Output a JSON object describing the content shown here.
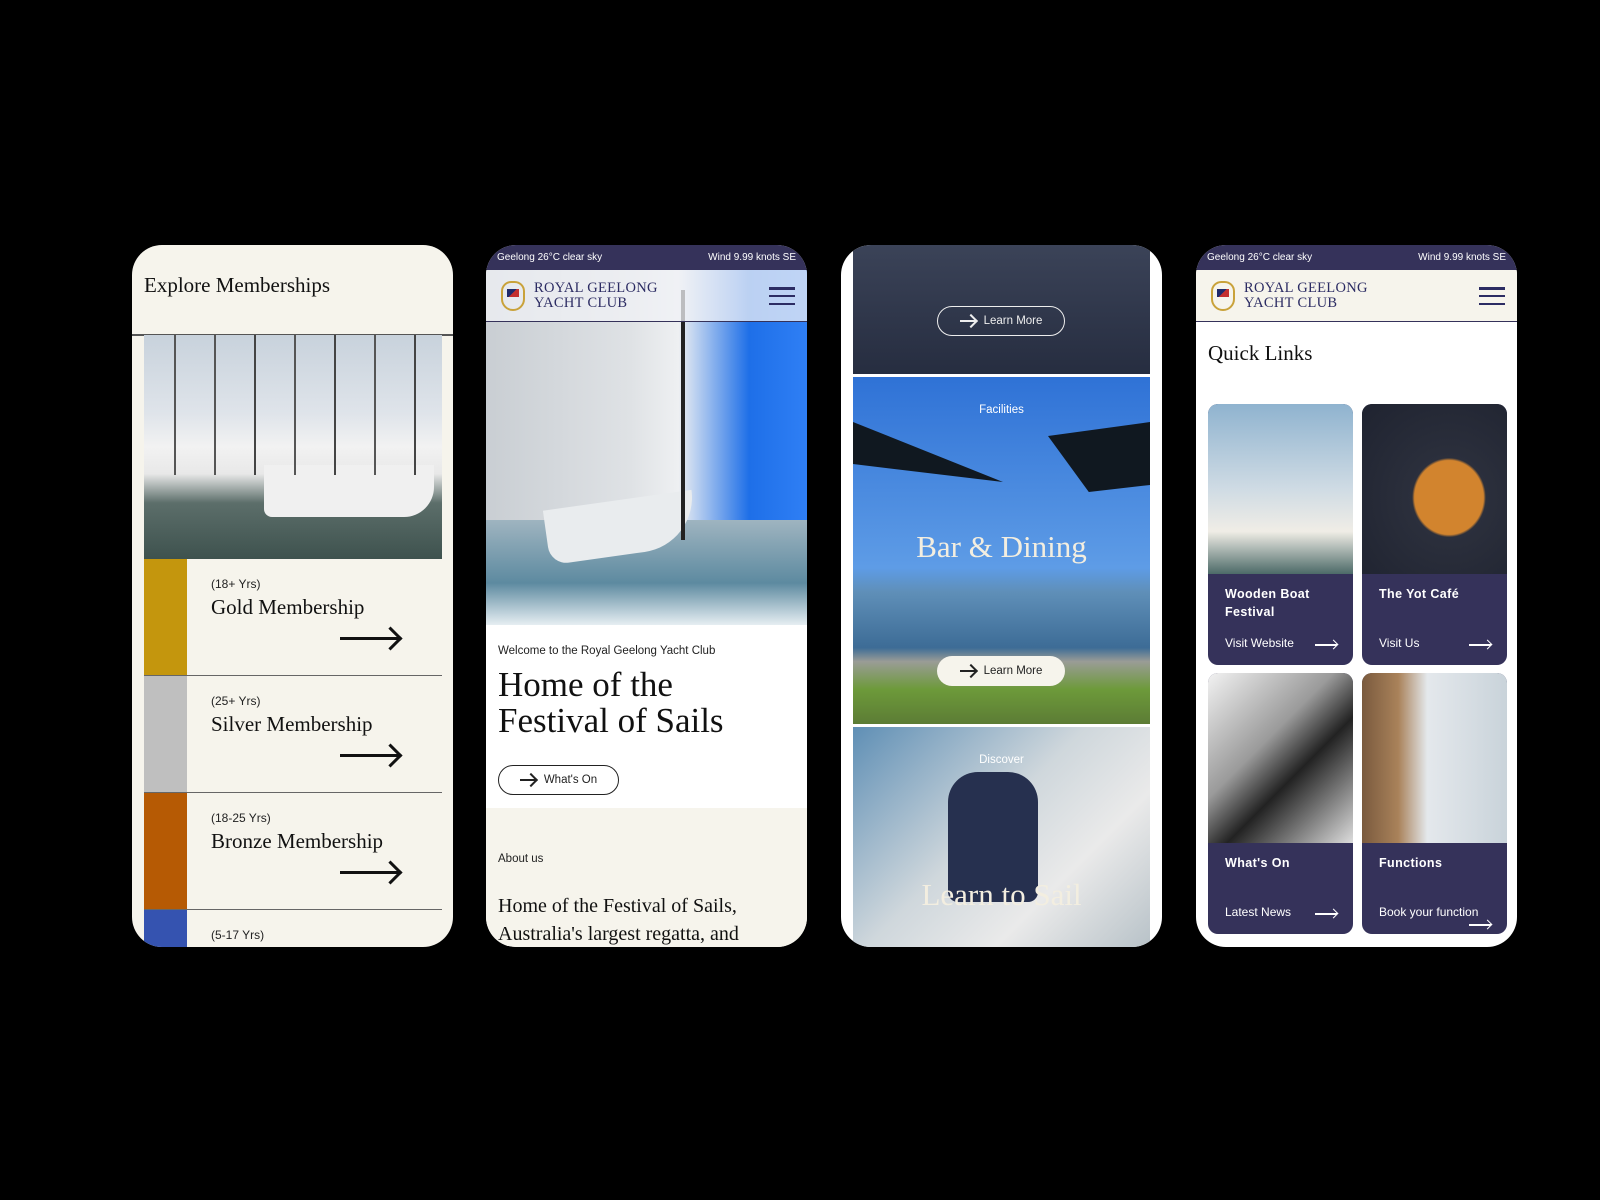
{
  "status_bar": {
    "weather": "Geelong 26°C clear sky",
    "wind": "Wind 9.99 knots SE"
  },
  "brand": {
    "line1": "ROYAL GEELONG",
    "line2": "YACHT CLUB"
  },
  "memberships": {
    "title": "Explore Memberships",
    "items": [
      {
        "age": "(18+ Yrs)",
        "name": "Gold Membership",
        "color": "#c4960d"
      },
      {
        "age": "(25+ Yrs)",
        "name": "Silver Membership",
        "color": "#bfbfbf"
      },
      {
        "age": "(18-25 Yrs)",
        "name": "Bronze Membership",
        "color": "#b65a04"
      },
      {
        "age": "(5-17 Yrs)",
        "name": "",
        "color": "#3553b0"
      }
    ]
  },
  "home": {
    "welcome": "Welcome to the Royal Geelong Yacht Club",
    "heading_line1": "Home of the",
    "heading_line2": "Festival of Sails",
    "whats_on_button": "What's On",
    "about_label": "About us",
    "about_line1": "Home of the Festival of Sails,",
    "about_line2": "Australia's largest regatta, and"
  },
  "features": {
    "learn_more": "Learn More",
    "bar_label": "Facilities",
    "bar_title": "Bar & Dining",
    "sail_label": "Discover",
    "sail_title": "Learn to Sail"
  },
  "quick_links": {
    "title": "Quick Links",
    "cards": [
      {
        "title": "Wooden Boat Festival",
        "link": "Visit Website"
      },
      {
        "title": "The Yot Café",
        "link": "Visit Us"
      },
      {
        "title": "What's On",
        "link": "Latest News"
      },
      {
        "title": "Functions",
        "link": "Book your function"
      }
    ]
  },
  "colors": {
    "navy": "#35325a",
    "cream": "#f6f4ec"
  }
}
